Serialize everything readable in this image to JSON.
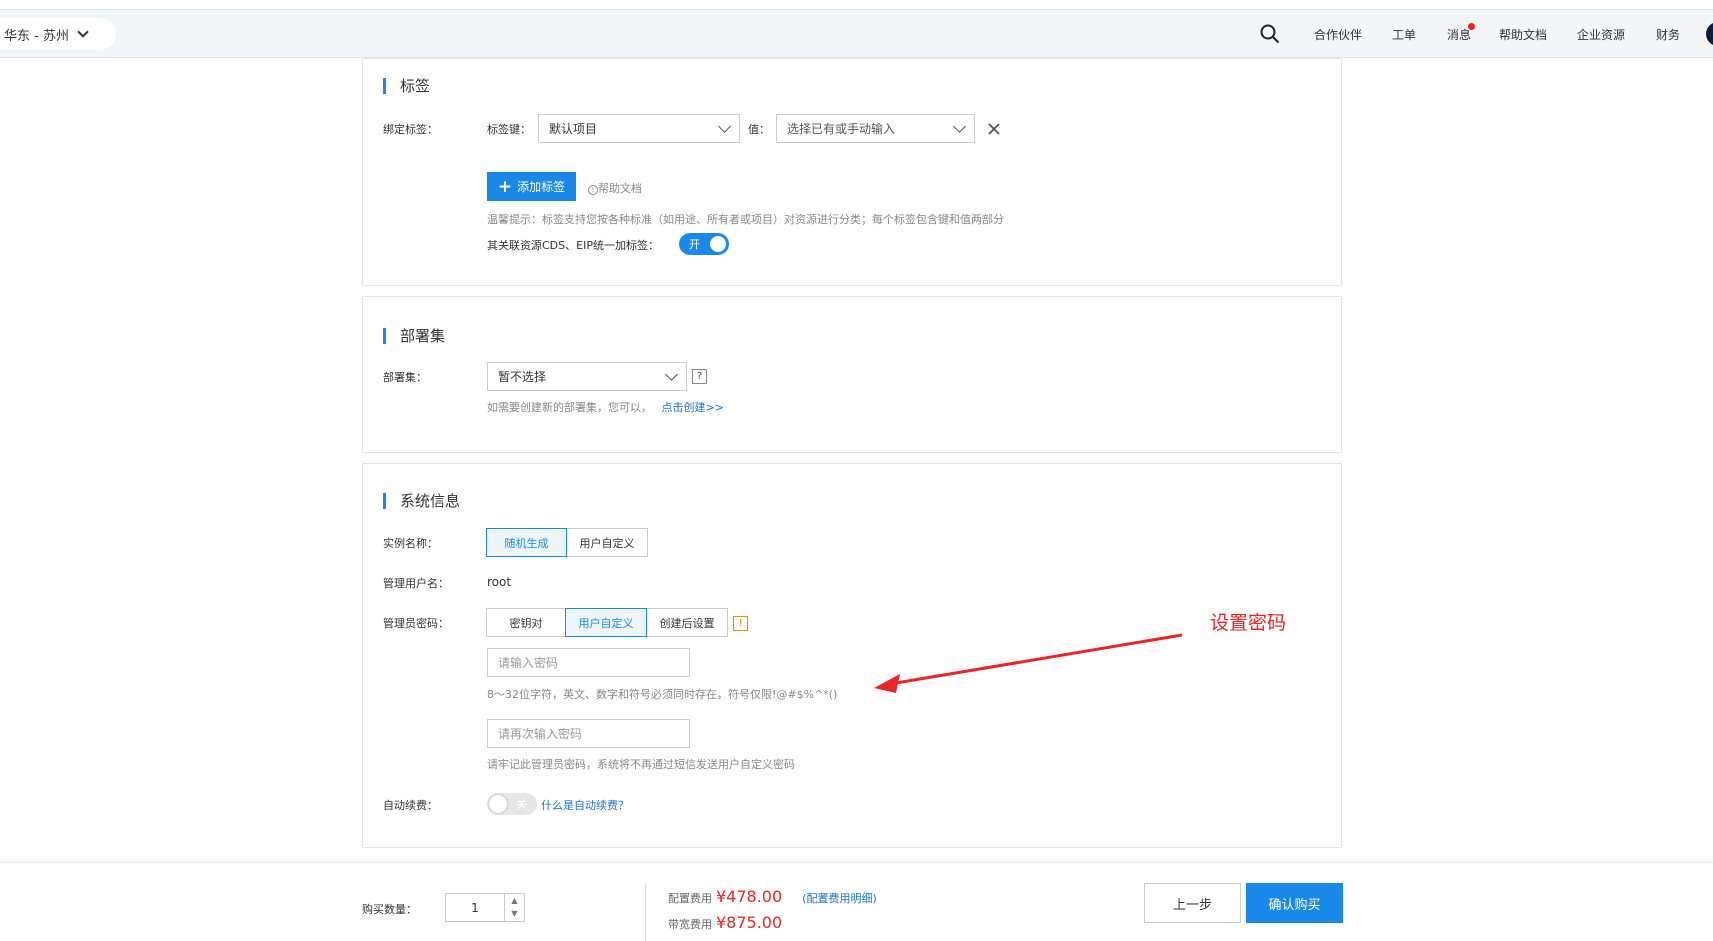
{
  "header": {
    "region": "华东 - 苏州",
    "nav": [
      "合作伙伴",
      "工单",
      "消息",
      "帮助文档",
      "企业资源",
      "财务"
    ]
  },
  "tags_section": {
    "title": "标签",
    "bind_label": "绑定标签：",
    "key_label": "标签键：",
    "key_value": "默认项目",
    "value_label": "值：",
    "value_placeholder": "选择已有或手动输入",
    "add_button": "添加标签",
    "help_link": "帮助文档",
    "tip": "温馨提示：标签支持您按各种标准（如用途、所有者或项目）对资源进行分类；每个标签包含键和值两部分",
    "unify_label": "其关联资源CDS、EIP统一加标签：",
    "unify_toggle": "开"
  },
  "deploy_section": {
    "title": "部署集",
    "label": "部署集：",
    "value": "暂不选择",
    "help": "?",
    "hint": "如需要创建新的部署集，您可以，",
    "create_link": "点击创建>>"
  },
  "system_section": {
    "title": "系统信息",
    "instance_name_label": "实例名称：",
    "instance_name_options": [
      "随机生成",
      "用户自定义"
    ],
    "instance_name_selected": "随机生成",
    "admin_user_label": "管理用户名：",
    "admin_user_value": "root",
    "admin_pwd_label": "管理员密码：",
    "admin_pwd_options": [
      "密钥对",
      "用户自定义",
      "创建后设置"
    ],
    "admin_pwd_selected": "用户自定义",
    "info_icon": "!",
    "pwd_placeholder": "请输入密码",
    "pwd_rule": "8～32位字符，英文、数字和符号必须同时存在，符号仅限!@#$%^*()",
    "pwd2_placeholder": "请再次输入密码",
    "pwd_note": "请牢记此管理员密码，系统将不再通过短信发送用户自定义密码",
    "auto_renew_label": "自动续费：",
    "auto_renew_toggle": "关",
    "auto_renew_link": "什么是自动续费？"
  },
  "annotation": "设置密码",
  "footer": {
    "qty_label": "购买数量：",
    "qty_value": "1",
    "config_fee_label": "配置费用",
    "config_fee": "¥478.00",
    "config_detail_link": "(配置费用明细)",
    "bandwidth_fee_label": "带宽费用",
    "bandwidth_fee": "¥875.00",
    "prev_button": "上一步",
    "buy_button": "确认购买"
  },
  "colors": {
    "accent": "#1a88e6",
    "price": "#e8262a",
    "annotation": "#e8262a"
  }
}
